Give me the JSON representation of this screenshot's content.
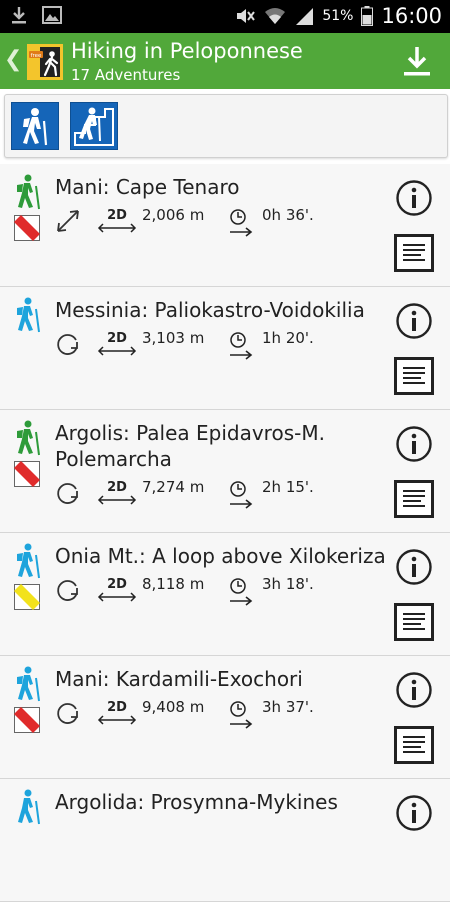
{
  "status_bar": {
    "battery_percent": "51%",
    "time": "16:00"
  },
  "header": {
    "title": "Hiking in Peloponnese",
    "subtitle": "17 Adventures",
    "logo_badge": "free"
  },
  "filters": [
    {
      "icon": "hiker-icon"
    },
    {
      "icon": "climber-icon"
    }
  ],
  "adventures": [
    {
      "name": "Mani: Cape Tenaro",
      "distance": "2,006 m",
      "duration": "0h 36'.",
      "hiker_color": "#2e9b3a",
      "marker_color": "#e02b2b",
      "route": "one-way"
    },
    {
      "name": "Messinia: Paliokastro-Voidokilia",
      "distance": "3,103 m",
      "duration": "1h 20'.",
      "hiker_color": "#1ea4dc",
      "marker_color": "",
      "route": "loop"
    },
    {
      "name": "Argolis: Palea Epidavros-M. Polemarcha",
      "distance": "7,274 m",
      "duration": "2h 15'.",
      "hiker_color": "#2e9b3a",
      "marker_color": "#e02b2b",
      "route": "loop"
    },
    {
      "name": "Onia Mt.: A loop above Xilokeriza",
      "distance": "8,118 m",
      "duration": "3h 18'.",
      "hiker_color": "#1ea4dc",
      "marker_color": "#f2e21b",
      "route": "loop"
    },
    {
      "name": "Mani: Kardamili-Exochori",
      "distance": "9,408 m",
      "duration": "3h 37'.",
      "hiker_color": "#1ea4dc",
      "marker_color": "#e02b2b",
      "route": "loop"
    },
    {
      "name": "Argolida: Prosymna-Mykines",
      "distance": "",
      "duration": "",
      "hiker_color": "#1ea4dc",
      "marker_color": "",
      "route": ""
    }
  ],
  "labels": {
    "dimension_badge": "2D"
  },
  "colors": {
    "appbar": "#51a83a",
    "filter_button": "#1565b8"
  }
}
